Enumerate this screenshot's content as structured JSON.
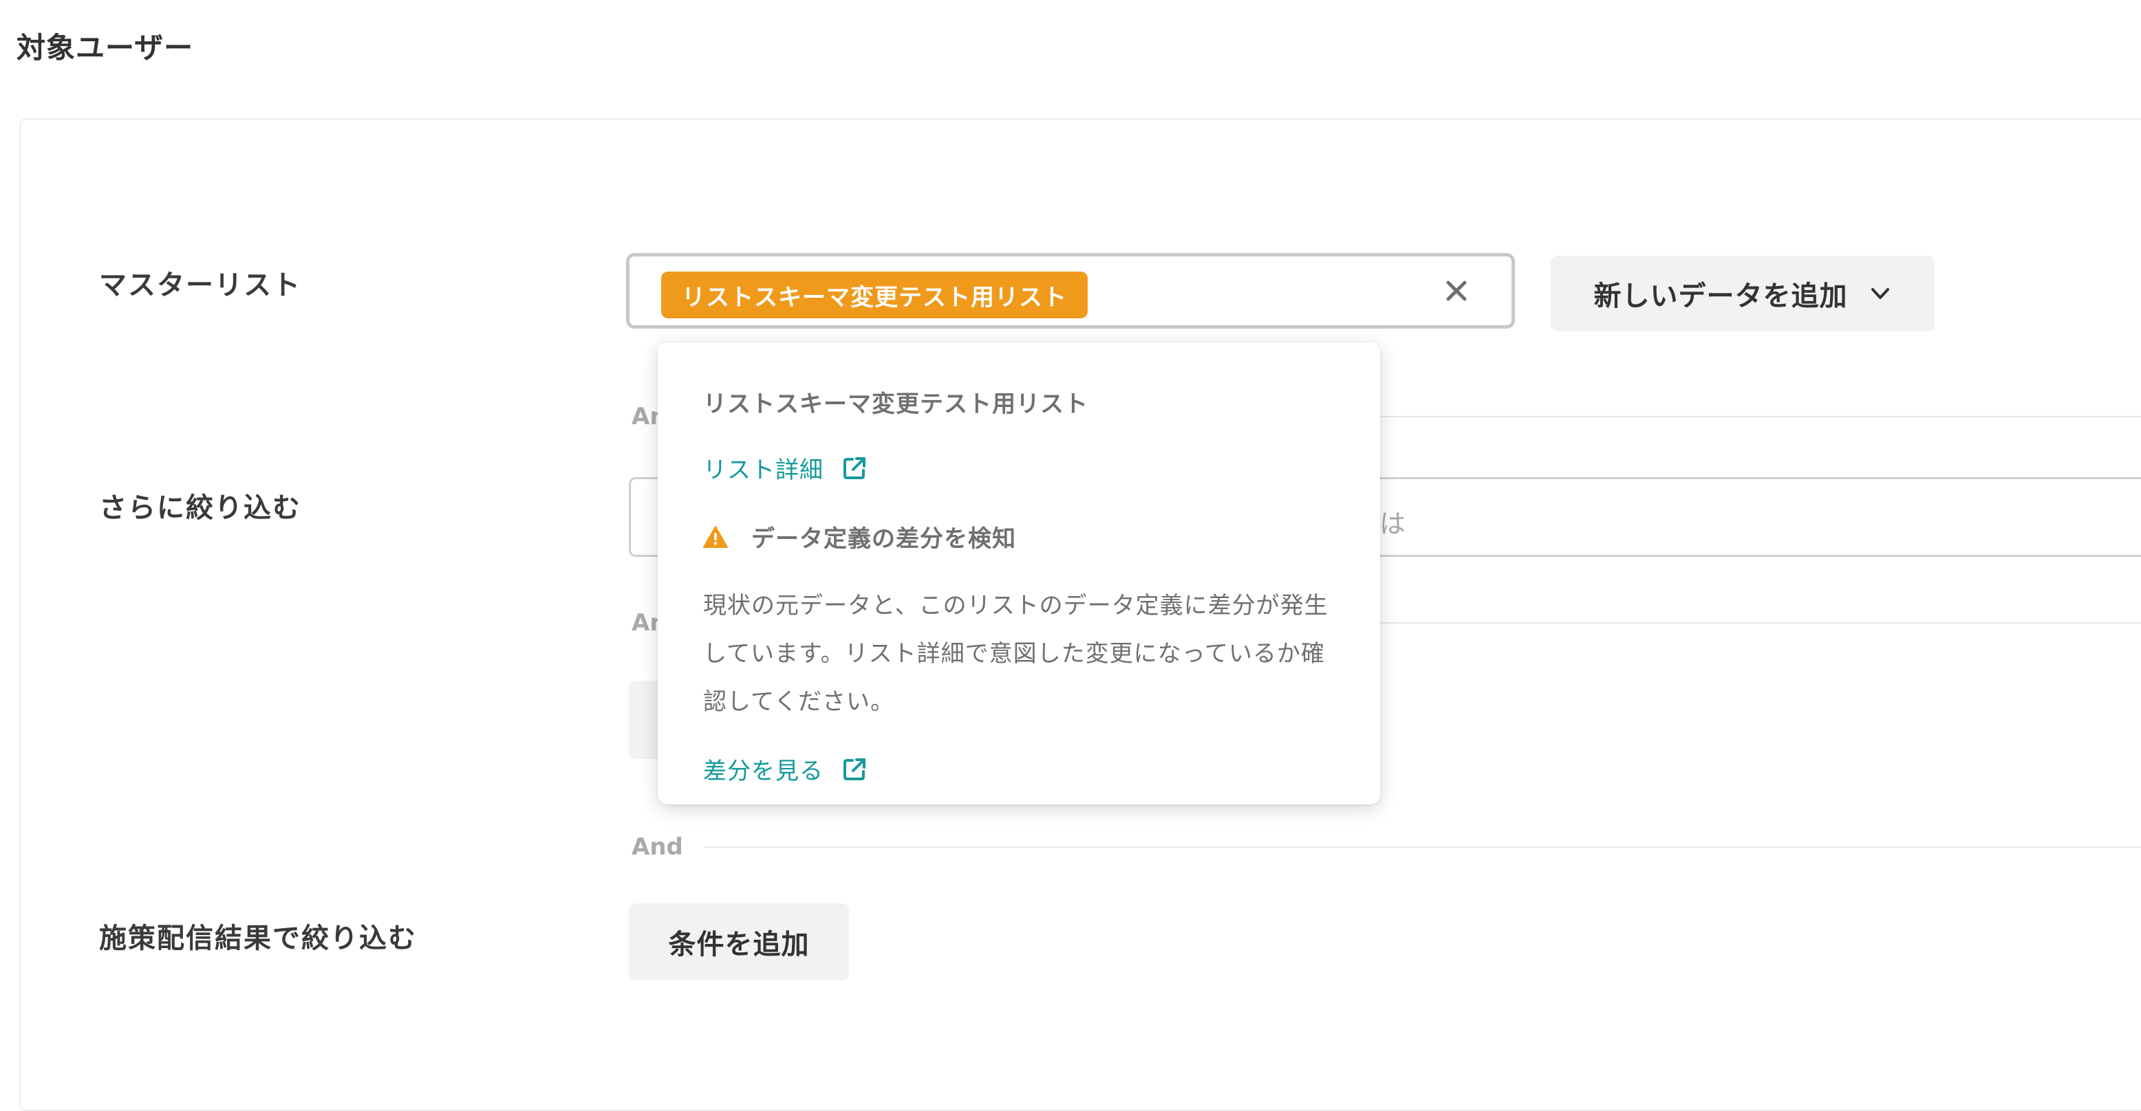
{
  "page": {
    "title": "対象ユーザー"
  },
  "rows": {
    "master_label": "マスターリスト",
    "narrow_label": "さらに絞り込む",
    "campaign_label": "施策配信結果で絞り込む"
  },
  "separators": {
    "and_1": "An",
    "and_2": "An",
    "and_3": "And"
  },
  "master_select": {
    "selected_tag": "リストスキーマ変更テスト用リスト",
    "clear_icon": "close-icon"
  },
  "add_data_button": {
    "label": "新しいデータを追加",
    "icon": "chevron-down-icon"
  },
  "filter_input": {
    "placeholder_fragment": "たは"
  },
  "add_condition_button": {
    "label": "条件を追加"
  },
  "popover": {
    "list_name": "リストスキーマ変更テスト用リスト",
    "list_detail_link": "リスト詳細",
    "warning_icon": "warning-icon",
    "warning_title": "データ定義の差分を検知",
    "warning_body_lines": [
      "現状の元データと、このリストのデータ定義に差分が発生",
      "しています。リスト詳細で意図した変更になっているか確",
      "認してください。"
    ],
    "diff_link": "差分を見る",
    "external_icon": "external-link-icon"
  },
  "colors": {
    "tag_orange": "#f09a1c",
    "link_teal": "#159a9c",
    "warning_orange": "#f09a1c",
    "button_gray": "#f1f2f2"
  }
}
